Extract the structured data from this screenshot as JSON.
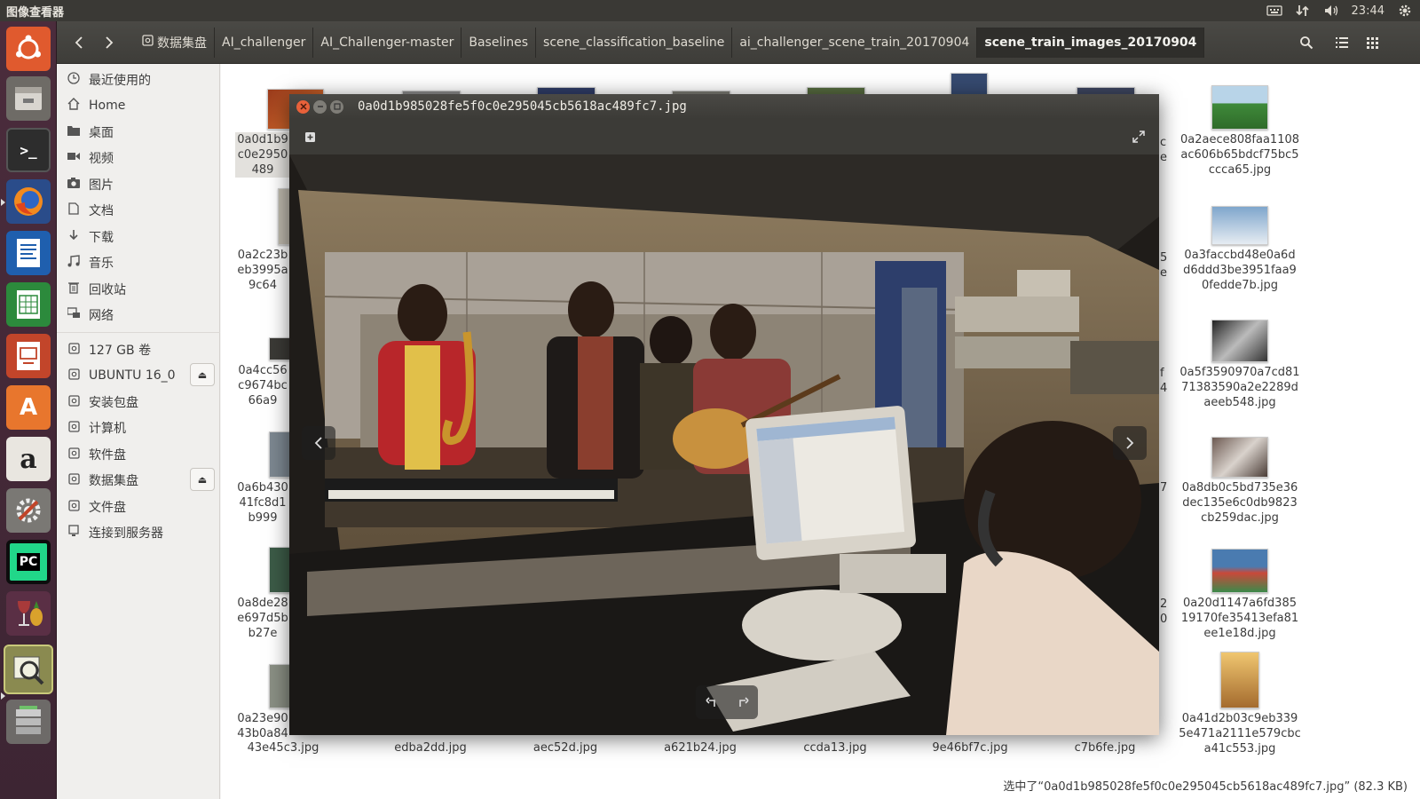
{
  "panel": {
    "app_title": "图像查看器",
    "clock": "23:44",
    "icons": [
      "keyboard-icon",
      "network-icon",
      "volume-icon",
      "settings-gear-icon"
    ]
  },
  "launcher": {
    "items": [
      "ubuntu-dash",
      "file-manager",
      "terminal",
      "firefox",
      "writer",
      "calc",
      "impress",
      "software-center",
      "amazon",
      "system-settings",
      "pycharm",
      "wine",
      "image-viewer",
      "disks"
    ]
  },
  "toolbar": {
    "back": "‹",
    "forward": "›",
    "path": [
      "数据集盘",
      "AI_challenger",
      "AI_Challenger-master",
      "Baselines",
      "scene_classification_baseline",
      "ai_challenger_scene_train_20170904",
      "scene_train_images_20170904"
    ]
  },
  "sidebar": {
    "places": [
      {
        "label": "最近使用的",
        "icon": "clock-icon"
      },
      {
        "label": "Home",
        "icon": "home-icon"
      },
      {
        "label": "桌面",
        "icon": "folder-icon"
      },
      {
        "label": "视频",
        "icon": "video-icon"
      },
      {
        "label": "图片",
        "icon": "camera-icon"
      },
      {
        "label": "文档",
        "icon": "document-icon"
      },
      {
        "label": "下载",
        "icon": "download-icon"
      },
      {
        "label": "音乐",
        "icon": "music-icon"
      },
      {
        "label": "回收站",
        "icon": "trash-icon"
      },
      {
        "label": "网络",
        "icon": "network-icon"
      }
    ],
    "devices": [
      {
        "label": "127 GB 卷",
        "eject": false
      },
      {
        "label": "UBUNTU 16_0",
        "eject": true
      },
      {
        "label": "安装包盘",
        "eject": false
      },
      {
        "label": "计算机",
        "eject": false
      },
      {
        "label": "软件盘",
        "eject": false
      },
      {
        "label": "数据集盘",
        "eject": true
      },
      {
        "label": "文件盘",
        "eject": false
      },
      {
        "label": "连接到服务器",
        "eject": false
      }
    ]
  },
  "files_left": [
    {
      "lines": [
        "0a0d1b9",
        "c0e2950",
        "489"
      ],
      "selected": true
    },
    {
      "lines": [
        "0a2c23b",
        "eb3995a",
        "9c64"
      ],
      "selected": false
    },
    {
      "lines": [
        "0a4cc56",
        "c9674bc",
        "66a9"
      ],
      "selected": false
    },
    {
      "lines": [
        "0a6b430",
        "41fc8d1",
        "b999"
      ],
      "selected": false
    },
    {
      "lines": [
        "0a8de28",
        "e697d5b",
        "b27e"
      ],
      "selected": false
    },
    {
      "lines": [
        "0a23e90",
        "43b0a84"
      ],
      "selected": false
    }
  ],
  "files_right": [
    {
      "lines": [
        "0a2aece808faa1108",
        "ac606b65bdcf75bc5",
        "ccca65.jpg"
      ],
      "color": "#3f8a3a"
    },
    {
      "lines": [
        "0a3faccbd48e0a6d",
        "d6ddd3be3951faa9",
        "0fedde7b.jpg"
      ],
      "color": "#9fb9d3"
    },
    {
      "lines": [
        "0a5f3590970a7cd81",
        "71383590a2e2289d",
        "aeeb548.jpg"
      ],
      "color": "#3a3a3a"
    },
    {
      "lines": [
        "0a8db0c5bd735e36",
        "dec135e6c0db9823",
        "cb259dac.jpg"
      ],
      "color": "#6d5a52"
    },
    {
      "lines": [
        "0a20d1147a6fd385",
        "19170fe35413efa81",
        "ee1e18d.jpg"
      ],
      "color": "#4a7bb0"
    },
    {
      "lines": [
        "0a41d2b03c9eb339",
        "5e471a2111e579cbc",
        "a41c553.jpg"
      ],
      "color": "#d9b26a"
    }
  ],
  "files_bottom": [
    "43e45c3.jpg",
    "edba2dd.jpg",
    "aec52d.jpg",
    "a621b24.jpg",
    "ccda13.jpg",
    "9e46bf7c.jpg",
    "c7b6fe.jpg"
  ],
  "edge_chars": [
    "c",
    "e",
    "5",
    "e",
    "f",
    "4",
    "7",
    "2",
    "0"
  ],
  "status": "选中了“0a0d1b985028fe5f0c0e295045cb5618ac489fc7.jpg” (82.3 KB)",
  "viewer": {
    "filename": "0a0d1b985028fe5f0c0e295045cb5618ac489fc7.jpg",
    "prev": "‹",
    "next": "›",
    "rotate_left": "↶",
    "rotate_right": "↷"
  }
}
